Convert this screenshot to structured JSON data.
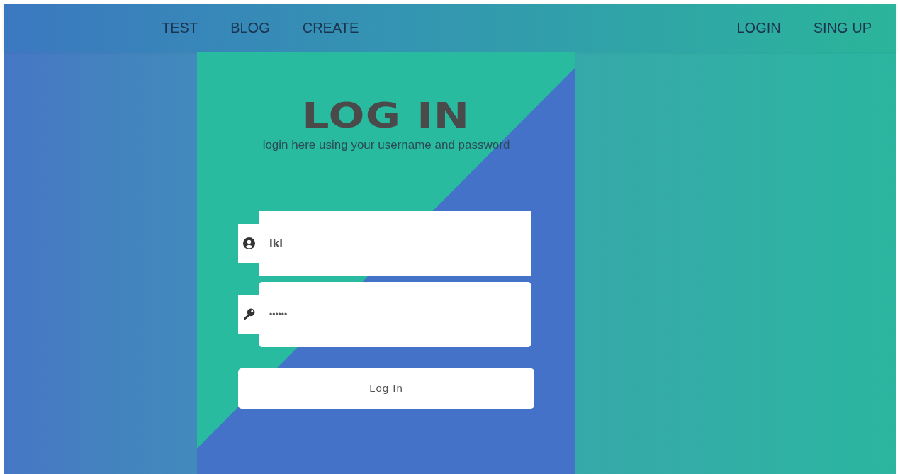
{
  "nav": {
    "left": [
      {
        "label": "TEST"
      },
      {
        "label": "BLOG"
      },
      {
        "label": "CREATE"
      }
    ],
    "right": [
      {
        "label": "LOGIN"
      },
      {
        "label": "SING UP"
      }
    ]
  },
  "card": {
    "title": "LOG IN",
    "subtitle": "login here using your username and password"
  },
  "fields": [
    {
      "kind": "user",
      "value": "lkl"
    },
    {
      "kind": "password",
      "value": "••••••"
    }
  ],
  "submit": "Log In"
}
